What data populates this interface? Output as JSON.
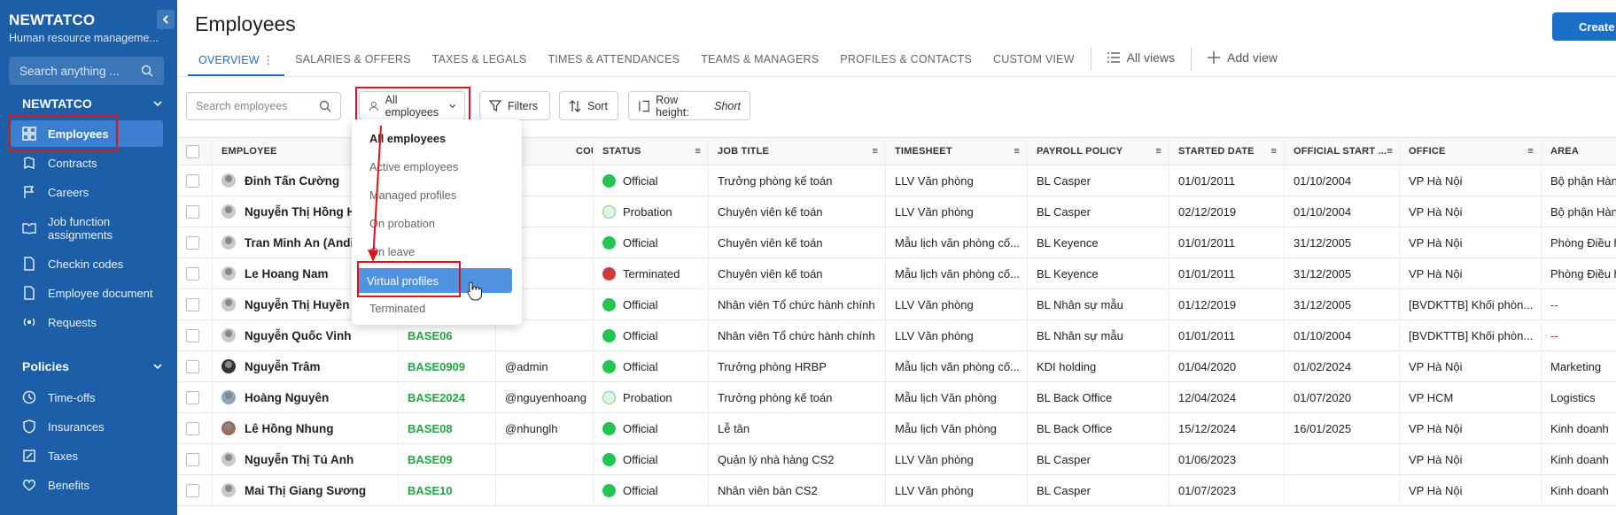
{
  "sidebar": {
    "company": "NEWTATCO",
    "subtitle": "Human resource manageme...",
    "search_placeholder": "Search anything ...",
    "org_section": "NEWTATCO",
    "items": [
      {
        "label": "Employees",
        "icon": "grid-icon"
      },
      {
        "label": "Contracts",
        "icon": "contract-icon"
      },
      {
        "label": "Careers",
        "icon": "flag-icon"
      },
      {
        "label": "Job function assignments",
        "icon": "book-icon"
      },
      {
        "label": "Checkin codes",
        "icon": "document-icon"
      },
      {
        "label": "Employee document",
        "icon": "document-icon"
      },
      {
        "label": "Requests",
        "icon": "broadcast-icon"
      }
    ],
    "policies_section": "Policies",
    "policy_items": [
      {
        "label": "Time-offs",
        "icon": "clock-icon"
      },
      {
        "label": "Insurances",
        "icon": "shield-icon"
      },
      {
        "label": "Taxes",
        "icon": "tax-icon"
      },
      {
        "label": "Benefits",
        "icon": "gift-icon"
      }
    ]
  },
  "header": {
    "title": "Employees",
    "create_label": "Create",
    "tabs": [
      "OVERVIEW",
      "SALARIES & OFFERS",
      "TAXES & LEGALS",
      "TIMES & ATTENDANCES",
      "TEAMS & MANAGERS",
      "PROFILES & CONTACTS",
      "CUSTOM VIEW"
    ],
    "all_views": "All views",
    "add_view": "Add view"
  },
  "toolbar": {
    "search_placeholder": "Search employees",
    "filter_value": "All employees",
    "filters_label": "Filters",
    "sort_label": "Sort",
    "row_height_label": "Row height:",
    "row_height_value": "Short"
  },
  "dropdown": {
    "options": [
      "All employees",
      "Active employees",
      "Managed profiles",
      "On probation",
      "On leave",
      "Virtual profiles",
      "Terminated"
    ],
    "selected": "Virtual profiles"
  },
  "table": {
    "columns": [
      "EMPLOYEE",
      "ACCOUNT",
      "STATUS",
      "JOB TITLE",
      "TIMESHEET",
      "PAYROLL POLICY",
      "STARTED DATE",
      "OFFICIAL START ...",
      "OFFICE",
      "AREA"
    ],
    "rows": [
      {
        "name": "Đinh Tấn Cường",
        "code": "",
        "account": "",
        "status": "Official",
        "job": "Trưởng phòng kế toán",
        "timesheet": "LLV Văn phòng",
        "payroll": "BL Casper",
        "started": "01/01/2011",
        "official": "01/10/2004",
        "office": "VP Hà Nội",
        "area": "Bộ phận Hàn"
      },
      {
        "name": "Nguyễn Thị Hồng H",
        "code": "",
        "account": "",
        "status": "Probation",
        "job": "Chuyên viên kế toán",
        "timesheet": "LLV Văn phòng",
        "payroll": "BL Casper",
        "started": "02/12/2019",
        "official": "01/10/2004",
        "office": "VP Hà Nội",
        "area": "Bộ phận Hàn"
      },
      {
        "name": "Tran Minh An (Andi",
        "code": "",
        "account": "",
        "status": "Official",
        "job": "Chuyên viên kế toán",
        "timesheet": "Mẫu lịch văn phòng cố...",
        "payroll": "BL Keyence",
        "started": "01/01/2011",
        "official": "31/12/2005",
        "office": "VP Hà Nội",
        "area": "Phòng Điều h"
      },
      {
        "name": "Le Hoang Nam",
        "code": "",
        "account": "",
        "status": "Terminated",
        "job": "Chuyên viên kế toán",
        "timesheet": "Mẫu lịch văn phòng cố...",
        "payroll": "BL Keyence",
        "started": "01/01/2011",
        "official": "31/12/2005",
        "office": "VP Hà Nội",
        "area": "Phòng Điều h"
      },
      {
        "name": "Nguyễn Thị Huyền",
        "code": "",
        "account": "",
        "status": "Official",
        "job": "Nhân viên Tổ chức hành chính",
        "timesheet": "LLV Văn phòng",
        "payroll": "BL Nhân sự mẫu",
        "started": "01/12/2019",
        "official": "31/12/2005",
        "office": "[BVDKTTB] Khối phòn...",
        "area": "--"
      },
      {
        "name": "Nguyễn Quốc Vinh",
        "code": "BASE06",
        "account": "",
        "status": "Official",
        "job": "Nhân viên Tổ chức hành chính",
        "timesheet": "LLV Văn phòng",
        "payroll": "BL Nhân sự mẫu",
        "started": "01/01/2011",
        "official": "01/10/2004",
        "office": "[BVDKTTB] Khối phòn...",
        "area": "--"
      },
      {
        "name": "Nguyễn Trâm",
        "code": "BASE0909",
        "account": "@admin",
        "status": "Official",
        "job": "Trưởng phòng HRBP",
        "timesheet": "Mẫu lịch văn phòng cố...",
        "payroll": "KDI holding",
        "started": "01/04/2020",
        "official": "01/02/2024",
        "office": "VP Hà Nội",
        "area": "Marketing"
      },
      {
        "name": "Hoàng Nguyên",
        "code": "BASE2024",
        "account": "@nguyenhoang",
        "status": "Probation",
        "job": "Trưởng phòng kế toán",
        "timesheet": "Mẫu lịch Văn phòng",
        "payroll": "BL Back Office",
        "started": "12/04/2024",
        "official": "01/07/2020",
        "office": "VP HCM",
        "area": "Logistics"
      },
      {
        "name": "Lê Hồng Nhung",
        "code": "BASE08",
        "account": "@nhunglh",
        "status": "Official",
        "job": "Lễ tân",
        "timesheet": "Mẫu lịch Văn phòng",
        "payroll": "BL Back Office",
        "started": "15/12/2024",
        "official": "16/01/2025",
        "office": "VP Hà Nội",
        "area": "Kinh doanh"
      },
      {
        "name": "Nguyễn Thị Tú Anh",
        "code": "BASE09",
        "account": "",
        "status": "Official",
        "job": "Quản lý nhà hàng CS2",
        "timesheet": "LLV Văn phòng",
        "payroll": "BL Casper",
        "started": "01/06/2023",
        "official": "",
        "office": "VP Hà Nội",
        "area": "Kinh doanh"
      },
      {
        "name": "Mai Thị Giang Sương",
        "code": "BASE10",
        "account": "",
        "status": "Official",
        "job": "Nhân viên bàn CS2",
        "timesheet": "LLV Văn phòng",
        "payroll": "BL Casper",
        "started": "01/07/2023",
        "official": "",
        "office": "VP Hà Nội",
        "area": "Kinh doanh"
      }
    ]
  },
  "colors": {
    "sidebar": "#1c5fa8",
    "accent": "#1c6fc9",
    "highlight": "#e2101a",
    "official": "#23c552",
    "terminated": "#d03a3a"
  }
}
